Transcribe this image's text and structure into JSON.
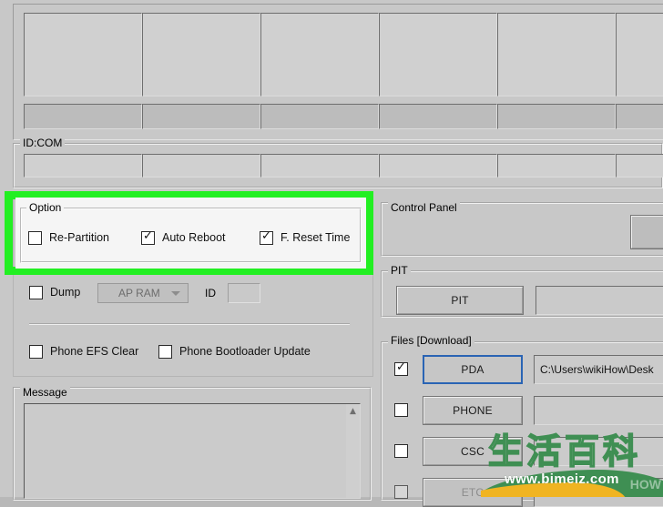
{
  "app": {
    "background_color": "#c8c8c8",
    "highlight_color": "#22ef22"
  },
  "device_panel": {
    "slots": [
      "",
      "",
      "",
      "",
      "",
      ""
    ],
    "status_cells": [
      "",
      "",
      "",
      "",
      "",
      ""
    ]
  },
  "idcom": {
    "caption": "ID:COM",
    "cells": [
      "",
      "",
      "",
      "",
      "",
      ""
    ]
  },
  "option": {
    "caption": "Option",
    "checkboxes": [
      {
        "label": "Re-Partition",
        "checked": false
      },
      {
        "label": "Auto Reboot",
        "checked": true
      },
      {
        "label": "F. Reset Time",
        "checked": true
      }
    ]
  },
  "dump_row": {
    "dump": {
      "label": "Dump",
      "checked": false
    },
    "combo": {
      "value": "AP RAM",
      "icon": "chevron-down-icon"
    },
    "id": {
      "label": "ID",
      "value": ""
    }
  },
  "phone_row": {
    "efs_clear": {
      "label": "Phone EFS Clear",
      "checked": false
    },
    "bootloader_update": {
      "label": "Phone Bootloader Update",
      "checked": false
    }
  },
  "message": {
    "caption": "Message",
    "text": "",
    "scroll_icon": "chevron-up-icon"
  },
  "control_panel": {
    "caption": "Control Panel",
    "button_label": ""
  },
  "pit": {
    "caption": "PIT",
    "button_label": "PIT",
    "path_value": ""
  },
  "files": {
    "caption": "Files [Download]",
    "rows": [
      {
        "checked": true,
        "button_label": "PDA",
        "path_value": "C:\\Users\\wikiHow\\Desk",
        "focused": true,
        "disabled": false
      },
      {
        "checked": false,
        "button_label": "PHONE",
        "path_value": "",
        "focused": false,
        "disabled": false
      },
      {
        "checked": false,
        "button_label": "CSC",
        "path_value": "",
        "focused": false,
        "disabled": false
      },
      {
        "checked": false,
        "button_label": "ETC",
        "path_value": "",
        "focused": false,
        "disabled": true
      }
    ]
  },
  "watermark": {
    "chinese": "生活百科",
    "url": "www.bimeiz.com",
    "corner": "HOW",
    "green": "#3f8f53",
    "yellow": "#f0b422"
  }
}
